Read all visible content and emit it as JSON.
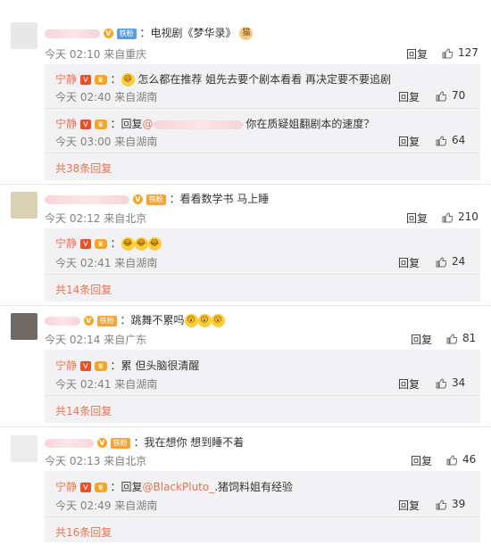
{
  "labels": {
    "reply": "回复",
    "reply_prefix": "回复",
    "reply_at": "@",
    "colon": "："
  },
  "badges": {
    "v": "V",
    "crown": "♛",
    "vip": "V",
    "fan": "铁粉"
  },
  "comments": [
    {
      "time": "今天 02:10 来自重庆",
      "text": "：电视剧《梦华录》",
      "emoji": "猫",
      "likes": "127",
      "replies": [
        {
          "user": "宁静",
          "time": "今天 02:40 来自湖南",
          "text": "怎么都在推荐 姐先去要个剧本看看 再决定要不要追剧",
          "likes": "70"
        },
        {
          "user": "宁静",
          "time": "今天 03:00 来自湖南",
          "text": "你在质疑姐翻剧本的速度？",
          "likes": "64"
        }
      ],
      "more": "共38条回复"
    },
    {
      "time": "今天 02:12 来自北京",
      "text": "：看看数学书 马上睡",
      "likes": "210",
      "replies": [
        {
          "user": "宁静",
          "time": "今天 02:41 来自湖南",
          "text": "",
          "likes": "24"
        }
      ],
      "more": "共14条回复"
    },
    {
      "time": "今天 02:14 来自广东",
      "text": "：跳舞不累吗",
      "likes": "81",
      "replies": [
        {
          "user": "宁静",
          "time": "今天 02:41 来自湖南",
          "text": "累 但头脑很清醒",
          "likes": "34"
        }
      ],
      "more": "共14条回复"
    },
    {
      "time": "今天 02:13 来自北京",
      "text": "：我在想你 想到睡不着",
      "likes": "46",
      "replies": [
        {
          "user": "宁静",
          "time": "今天 02:49 来自湖南",
          "mention": "BlackPluto_",
          "text": ".猪饲料姐有经验",
          "likes": "39"
        }
      ],
      "more": "共16条回复"
    }
  ]
}
